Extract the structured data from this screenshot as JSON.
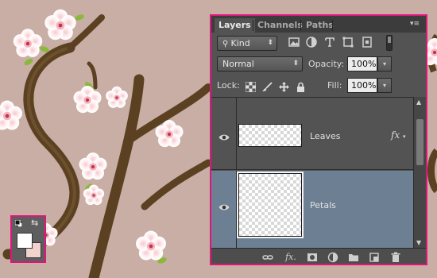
{
  "colors": {
    "highlight_border": "#e0157a",
    "selected_layer": "#6d7f93",
    "panel_bg": "#535353",
    "canvas_bg": "#c8aea4",
    "foreground_color": "#ffffff",
    "background_color": "#f2d2cc"
  },
  "panel": {
    "tabs": [
      {
        "label": "Layers",
        "active": true
      },
      {
        "label": "Channels",
        "active": false
      },
      {
        "label": "Paths",
        "active": false
      }
    ],
    "menu_icon": "panel-menu-icon",
    "filter": {
      "kind_label": "Kind",
      "icons": [
        "image-filter-icon",
        "adjustment-filter-icon",
        "type-filter-icon",
        "shape-filter-icon",
        "smart-object-filter-icon"
      ]
    },
    "blend_mode": "Normal",
    "opacity_label": "Opacity:",
    "opacity_value": "100%",
    "lock_label": "Lock:",
    "lock_icons": [
      "lock-transparent-icon",
      "lock-image-icon",
      "lock-position-icon",
      "lock-all-icon"
    ],
    "fill_label": "Fill:",
    "fill_value": "100%",
    "layers": [
      {
        "name": "Leaves",
        "visible": true,
        "selected": false,
        "fx": "fx"
      },
      {
        "name": "Petals",
        "visible": true,
        "selected": true
      }
    ],
    "footer_icons": [
      "link-layers-icon",
      "layer-style-icon",
      "layer-mask-icon",
      "adjustment-layer-icon",
      "new-group-icon",
      "new-layer-icon",
      "delete-layer-icon"
    ],
    "footer_fx": "fx."
  }
}
